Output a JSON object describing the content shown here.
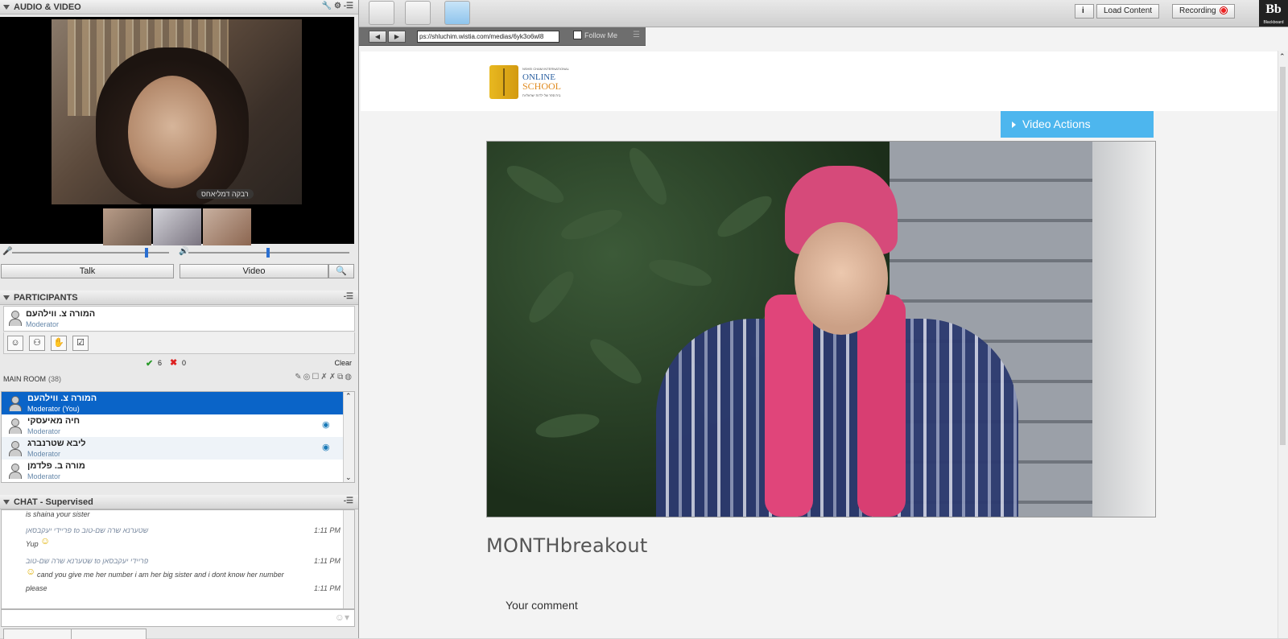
{
  "left_panel": {
    "audio_video": {
      "title": "AUDIO & VIDEO",
      "caption_main": "רבקה דמליאחס",
      "talk_label": "Talk",
      "video_label": "Video"
    },
    "participants": {
      "title": "PARTICIPANTS",
      "me": {
        "name": "המורה צ. ווילהעם",
        "role": "Moderator"
      },
      "yes_count": "6",
      "no_count": "0",
      "clear_label": "Clear",
      "room_label": "MAIN ROOM",
      "room_count": "(38)",
      "list": [
        {
          "name": "המורה צ. ווילהעם",
          "role": "Moderator (You)"
        },
        {
          "name": "חיה מאיעסקי",
          "role": "Moderator"
        },
        {
          "name": "ליבא שטרנברג",
          "role": "Moderator"
        },
        {
          "name": "מורה ב. פלדמן",
          "role": "Moderator"
        }
      ]
    },
    "chat": {
      "title": "CHAT - Supervised",
      "messages": [
        {
          "text": "is shaina your sister"
        },
        {
          "meta": "פריידי יעקבסאן to שטערנא שרה שם-טוב",
          "time": "1:11 PM",
          "text": "Yup"
        },
        {
          "meta": "שטערנא שרה שם-טוב to פריידי יעקבסאן",
          "time": "1:11 PM",
          "text": "cand you give me her number i am her big sister and i dont know her number"
        },
        {
          "text": "please",
          "time": "1:11 PM"
        }
      ]
    }
  },
  "toolbar": {
    "load_content": "Load Content",
    "recording": "Recording",
    "brand": "Bb",
    "brand_sub": "Blackboard"
  },
  "browser": {
    "url": "ps://shluchim.wistia.com/medias/6yk3o6wl8",
    "follow_me": "Follow Me"
  },
  "page": {
    "logo_small": "NSHEI CHAM INTERNATIONAL",
    "logo_line1": "ONLINE",
    "logo_line2": "SCHOOL",
    "logo_tag": "בית ספר של ילדות ישראליות",
    "video_actions": "Video Actions",
    "post_title": "MONTHbreakout",
    "comment_label": "Your comment"
  }
}
